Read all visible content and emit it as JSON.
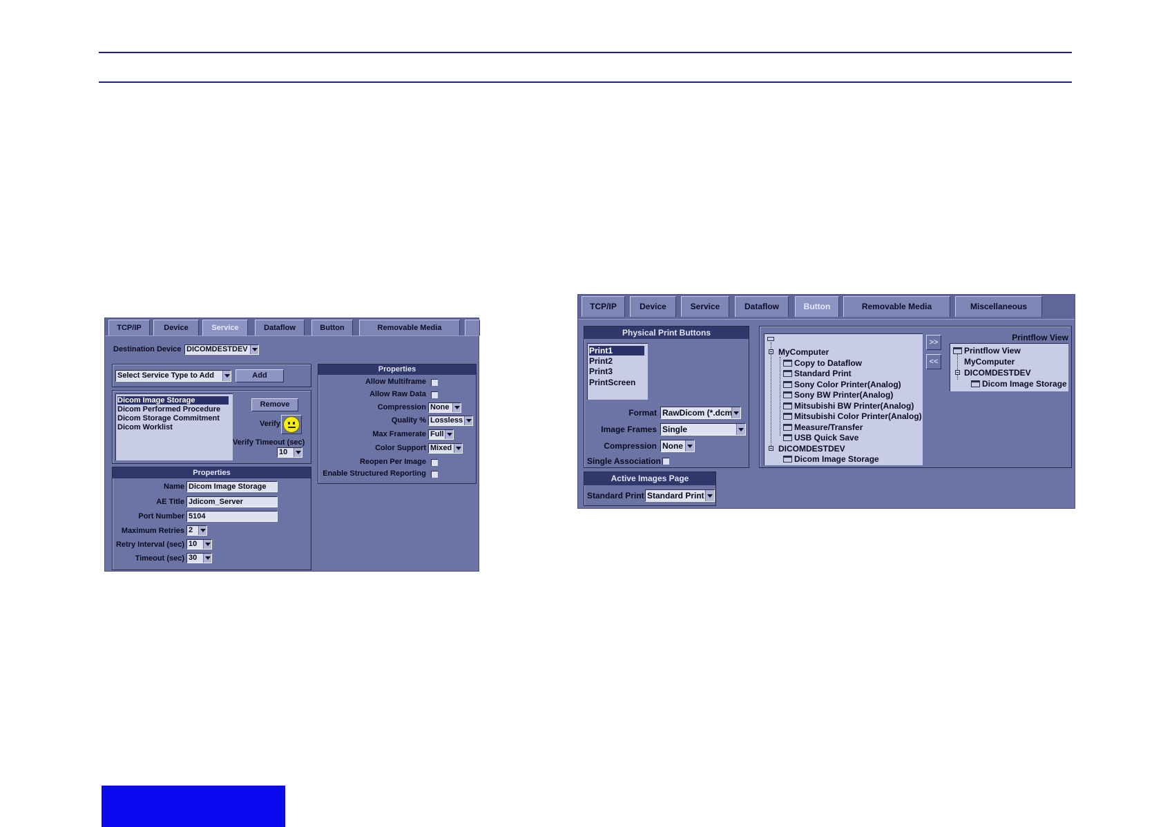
{
  "left_panel": {
    "tabs": [
      "TCP/IP",
      "Device",
      "Service",
      "Dataflow",
      "Button",
      "Removable Media"
    ],
    "active_tab": "Service",
    "destination_device_label": "Destination Device",
    "destination_device_value": "DICOMDESTDEV",
    "service_type_select": "Select Service Type to Add",
    "add_button": "Add",
    "services": [
      "Dicom Image Storage",
      "Dicom Performed Procedure",
      "Dicom Storage Commitment",
      "Dicom Worklist"
    ],
    "remove_button": "Remove",
    "verify_label": "Verify",
    "verify_timeout_label": "Verify Timeout (sec)",
    "verify_timeout_value": "10",
    "properties_header": "Properties",
    "name_label": "Name",
    "name_value": "Dicom Image Storage",
    "ae_title_label": "AE Title",
    "ae_title_value": "Jdicom_Server",
    "port_label": "Port Number",
    "port_value": "5104",
    "max_retries_label": "Maximum Retries",
    "max_retries_value": "2",
    "retry_interval_label": "Retry Interval (sec)",
    "retry_interval_value": "10",
    "timeout_label": "Timeout (sec)",
    "timeout_value": "30",
    "right_properties_header": "Properties",
    "allow_multiframe_label": "Allow Multiframe",
    "allow_raw_label": "Allow Raw Data",
    "compression_label": "Compression",
    "compression_value": "None",
    "quality_label": "Quality %",
    "quality_value": "Lossless",
    "max_framerate_label": "Max Framerate",
    "max_framerate_value": "Full",
    "color_support_label": "Color Support",
    "color_support_value": "Mixed",
    "reopen_label": "Reopen Per Image",
    "structured_label": "Enable Structured Reporting"
  },
  "right_panel": {
    "tabs": [
      "TCP/IP",
      "Device",
      "Service",
      "Dataflow",
      "Button",
      "Removable Media",
      "Miscellaneous"
    ],
    "active_tab": "Button",
    "physical_header": "Physical Print Buttons",
    "print_buttons": [
      "Print1",
      "Print2",
      "Print3",
      "PrintScreen"
    ],
    "format_label": "Format",
    "format_value": "RawDicom (*.dcm)",
    "image_frames_label": "Image Frames",
    "image_frames_value": "Single",
    "compression_label": "Compression",
    "compression_value": "None",
    "single_assoc_label": "Single Association",
    "tree_root_1": "MyComputer",
    "tree_children_1": [
      "Copy to Dataflow",
      "Standard Print",
      "Sony Color Printer(Analog)",
      "Sony BW Printer(Analog)",
      "Mitsubishi BW Printer(Analog)",
      "Mitsubishi Color Printer(Analog)",
      "Measure/Transfer",
      "USB Quick Save"
    ],
    "tree_root_2": "DICOMDESTDEV",
    "tree_children_2": [
      "Dicom Image Storage"
    ],
    "add_arrow": ">>",
    "remove_arrow": "<<",
    "printflow_label": "Printflow View",
    "printflow_root": "Printflow View",
    "printflow_items": [
      "MyComputer",
      "DICOMDESTDEV",
      "Dicom Image Storage"
    ],
    "active_images_header": "Active Images Page",
    "standard_print_label": "Standard Print",
    "standard_print_value": "Standard Print"
  }
}
